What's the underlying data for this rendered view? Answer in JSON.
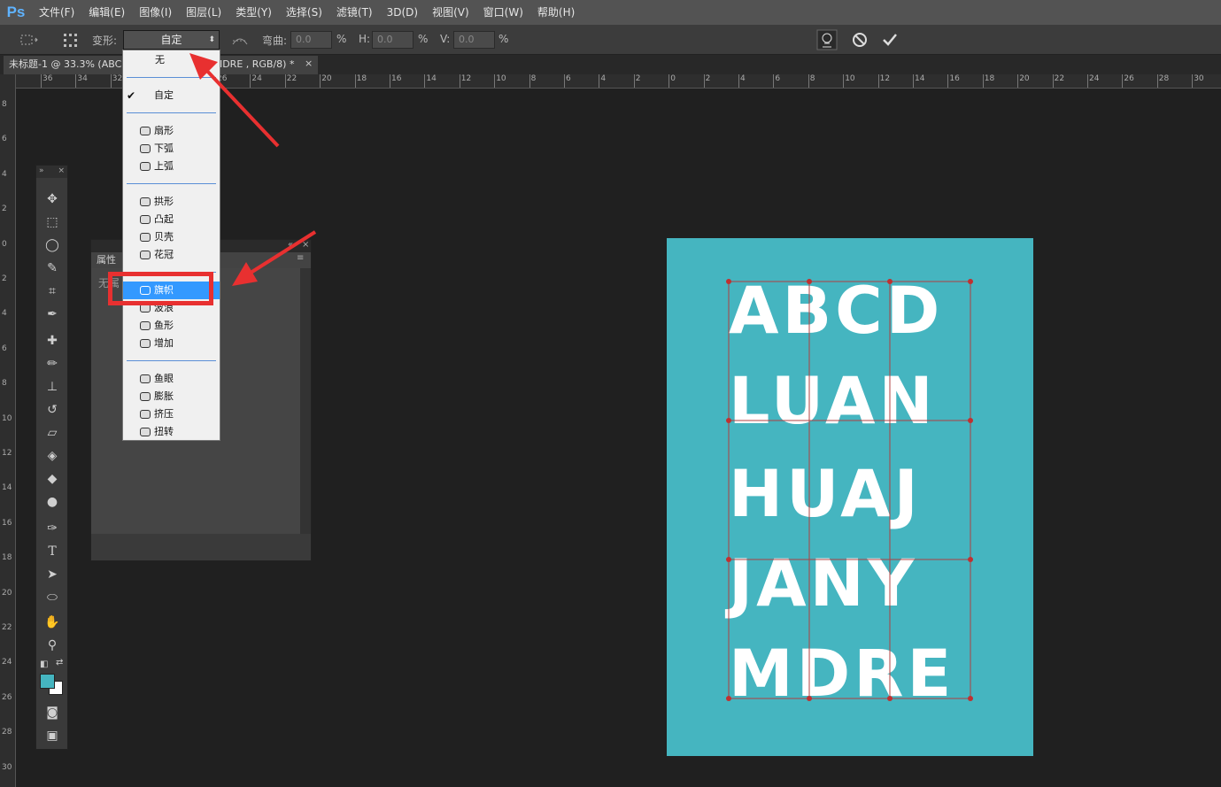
{
  "app": {
    "logo": "Ps"
  },
  "menu": [
    "文件(F)",
    "编辑(E)",
    "图像(I)",
    "图层(L)",
    "类型(Y)",
    "选择(S)",
    "滤镜(T)",
    "3D(D)",
    "视图(V)",
    "窗口(W)",
    "帮助(H)"
  ],
  "options": {
    "warp_label": "变形:",
    "warp_value": "自定",
    "bend_label": "弯曲:",
    "bend_value": "0.0",
    "h_label": "H:",
    "h_value": "0.0",
    "v_label": "V:",
    "v_value": "0.0",
    "percent": "%"
  },
  "tab": {
    "title": "未标题-1 @ 33.3% (ABCD LUAN HUAJ JANY MDRE , RGB/8) *"
  },
  "hruler_labels": [
    "36",
    "34",
    "32",
    "30",
    "28",
    "26",
    "24",
    "22",
    "20",
    "18",
    "16",
    "14",
    "12",
    "10",
    "8",
    "6",
    "4",
    "2",
    "0",
    "2",
    "4",
    "6",
    "8",
    "10",
    "12",
    "14",
    "16",
    "18",
    "20",
    "22",
    "24",
    "26",
    "28",
    "30"
  ],
  "vruler_labels": [
    "8",
    "6",
    "4",
    "2",
    "0",
    "2",
    "4",
    "6",
    "8",
    "10",
    "12",
    "14",
    "16",
    "18",
    "20",
    "22",
    "24",
    "26",
    "28",
    "30"
  ],
  "properties": {
    "title": "属性",
    "body": "无属"
  },
  "dropdown": {
    "items": [
      {
        "label": "无",
        "icon": "none"
      },
      {
        "label": "自定",
        "icon": "check",
        "checked": true
      },
      {
        "label": "扇形",
        "icon": "arc-icon"
      },
      {
        "label": "下弧",
        "icon": "arc-lower-icon"
      },
      {
        "label": "上弧",
        "icon": "arc-upper-icon"
      },
      {
        "label": "拱形",
        "icon": "arch-icon"
      },
      {
        "label": "凸起",
        "icon": "bulge-icon"
      },
      {
        "label": "贝壳",
        "icon": "shell-icon"
      },
      {
        "label": "花冠",
        "icon": "flower-icon"
      },
      {
        "label": "旗帜",
        "icon": "flag-icon",
        "selected": true
      },
      {
        "label": "波浪",
        "icon": "wave-icon"
      },
      {
        "label": "鱼形",
        "icon": "fish-icon"
      },
      {
        "label": "增加",
        "icon": "rise-icon"
      },
      {
        "label": "鱼眼",
        "icon": "fisheye-icon"
      },
      {
        "label": "膨胀",
        "icon": "inflate-icon"
      },
      {
        "label": "挤压",
        "icon": "squeeze-icon"
      },
      {
        "label": "扭转",
        "icon": "twist-icon"
      }
    ]
  },
  "canvas": {
    "background": "#45b5c0",
    "lines": [
      "ABCD",
      "LUAN",
      "HUAJ",
      "JANY",
      "MDRE"
    ]
  },
  "colors": {
    "accent_select": "#3399ff",
    "annotation_red": "#e83030",
    "foreground": "#45b5c0",
    "background": "#ffffff"
  }
}
